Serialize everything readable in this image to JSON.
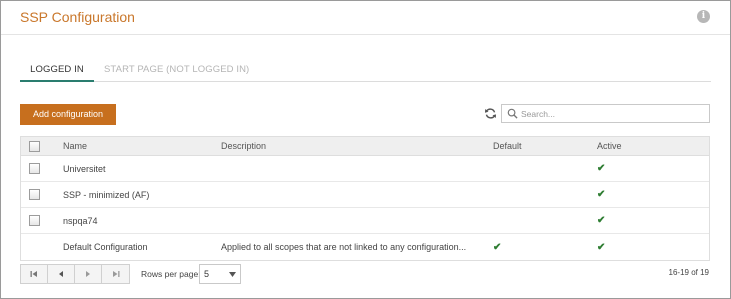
{
  "header": {
    "title": "SSP Configuration",
    "info_glyph": "i"
  },
  "tabs": [
    {
      "label": "LOGGED IN",
      "active": true
    },
    {
      "label": "START PAGE (NOT LOGGED IN)",
      "active": false
    }
  ],
  "toolbar": {
    "add_label": "Add configuration",
    "search_placeholder": "Search...",
    "search_value": ""
  },
  "grid": {
    "columns": [
      "Name",
      "Description",
      "Default",
      "Active"
    ],
    "check_glyph": "✔",
    "rows": [
      {
        "name": "Universitet",
        "description": "",
        "default": false,
        "active": true,
        "selectable": true
      },
      {
        "name": "SSP - minimized (AF)",
        "description": "",
        "default": false,
        "active": true,
        "selectable": true
      },
      {
        "name": "nspqa74",
        "description": "",
        "default": false,
        "active": true,
        "selectable": true
      },
      {
        "name": "Default Configuration",
        "description": "Applied to all scopes that are not linked to any configuration...",
        "default": true,
        "active": true,
        "selectable": false
      }
    ]
  },
  "pagination": {
    "rows_per_page_label": "Rows per page:",
    "rows_per_page_value": "5",
    "page_info": "16-19 of 19"
  },
  "colors": {
    "title": "#c9772b",
    "button": "#c76f1e",
    "tab_underline": "#2a7d6f",
    "check": "#2e7d32"
  },
  "icons": {
    "info": "info-icon",
    "refresh": "refresh-icon",
    "search": "search-icon",
    "first_page": "first-page-icon",
    "prev_page": "prev-page-icon",
    "next_page": "next-page-icon",
    "last_page": "last-page-icon",
    "dropdown": "chevron-down-icon"
  }
}
